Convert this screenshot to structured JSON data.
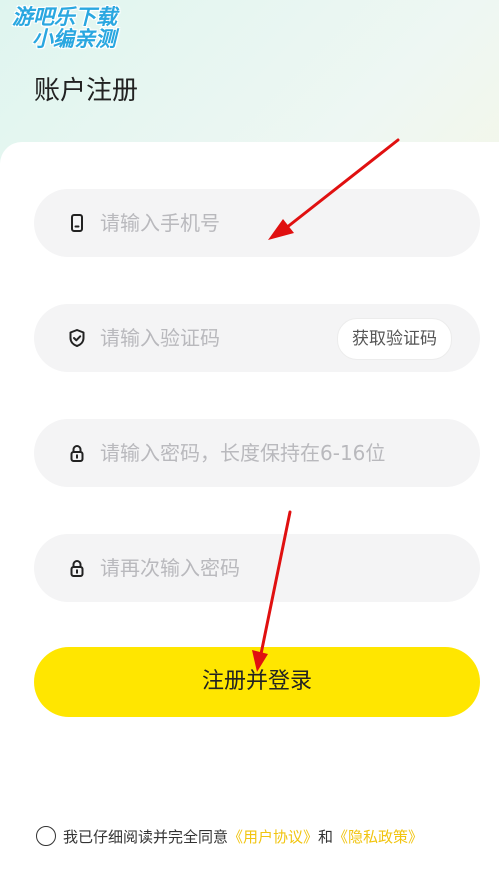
{
  "watermark": {
    "line1": "游吧乐下载",
    "line2": "小编亲测"
  },
  "page_title": "账户注册",
  "fields": [
    {
      "name": "phone",
      "placeholder": "请输入手机号",
      "icon": "phone-icon"
    },
    {
      "name": "code",
      "placeholder": "请输入验证码",
      "icon": "shield-check-icon",
      "action": "获取验证码"
    },
    {
      "name": "password",
      "placeholder": "请输入密码，长度保持在6-16位",
      "icon": "lock-icon"
    },
    {
      "name": "password_confirm",
      "placeholder": "请再次输入密码",
      "icon": "lock-icon"
    }
  ],
  "submit_label": "注册并登录",
  "agreement": {
    "text": "我已仔细阅读并完全同意",
    "user_agreement": "《用户协议》",
    "and": "和",
    "privacy_policy": "《隐私政策》"
  },
  "colors": {
    "accent": "#ffe600",
    "link": "#f1c40f",
    "annotation_arrow": "#e01010"
  }
}
